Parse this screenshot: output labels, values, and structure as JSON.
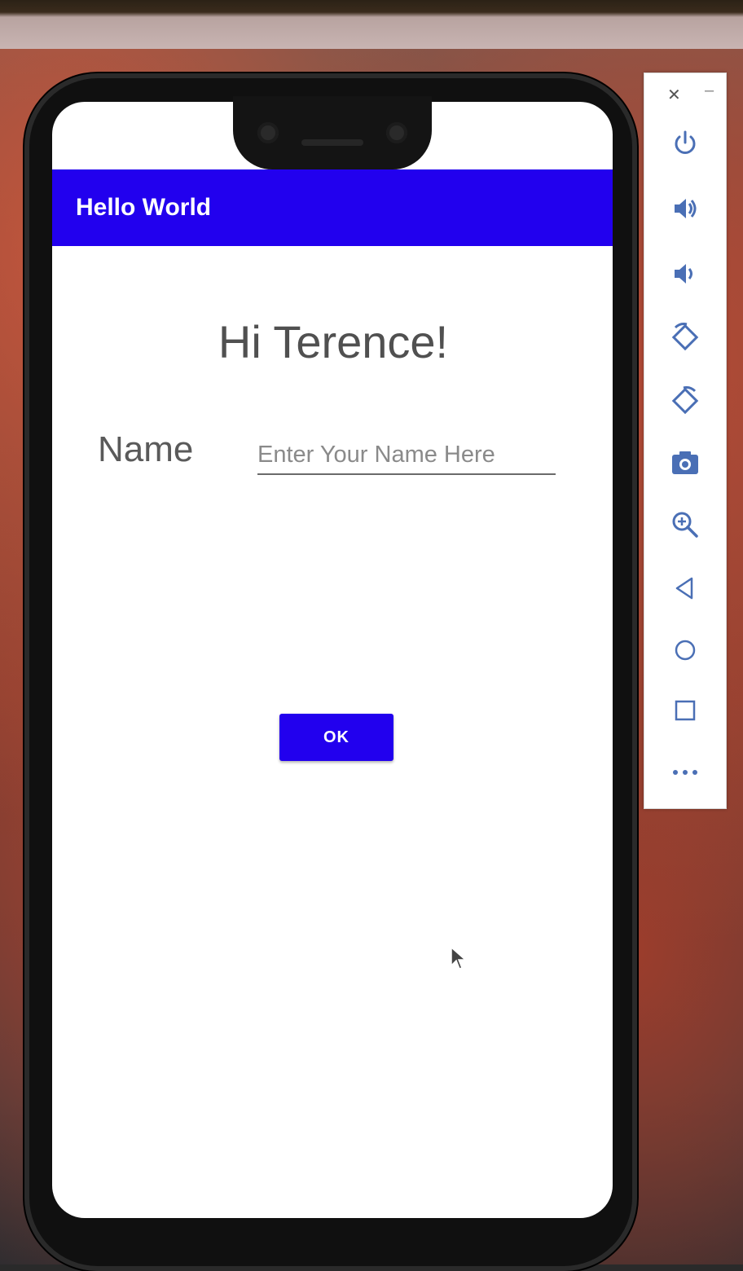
{
  "app": {
    "title": "Hello World",
    "greeting": "Hi Terence!",
    "name_label": "Name",
    "name_input": {
      "placeholder": "Enter Your Name Here",
      "value": ""
    },
    "ok_label": "OK"
  },
  "colors": {
    "primary": "#2200ee",
    "toolbar_icon": "#4a6fb5"
  },
  "emulator_toolbar": {
    "icons": [
      "close-icon",
      "minimize-icon",
      "power-icon",
      "volume-up-icon",
      "volume-down-icon",
      "rotate-left-icon",
      "rotate-right-icon",
      "camera-icon",
      "zoom-icon",
      "back-icon",
      "home-icon",
      "overview-icon",
      "more-icon"
    ]
  }
}
